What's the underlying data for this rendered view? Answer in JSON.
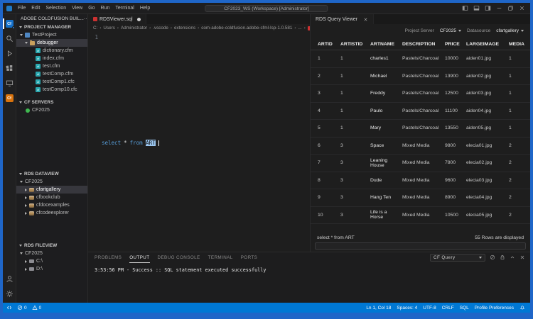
{
  "window": {
    "title": "CF2023_WS (Workspace) [Administrator]",
    "menus": [
      "File",
      "Edit",
      "Selection",
      "View",
      "Go",
      "Run",
      "Terminal",
      "Help"
    ],
    "controls": [
      "toggle-sidebar",
      "toggle-panel",
      "toggle-secondary-sidebar",
      "minimize",
      "restore",
      "close"
    ]
  },
  "activity_bar": {
    "icons": [
      "coldfusion-extension",
      "search",
      "run-debug",
      "extensions",
      "remote-explorer",
      "coldfusion-builder",
      "account",
      "settings-gear"
    ],
    "active": "coldfusion-extension",
    "cf_glyph": "Cf"
  },
  "sidebar": {
    "title": "ADOBE COLDFUSION BUIL...",
    "more_actions": "⋯",
    "sections": [
      {
        "label": "PROJECT MANAGER",
        "items": [
          {
            "label": "TestProject",
            "indent": 0,
            "chevron": "down",
            "icon": "project"
          },
          {
            "label": "debugger",
            "indent": 1,
            "chevron": "down",
            "icon": "folder",
            "selected": true
          },
          {
            "label": "dictionary.cfm",
            "indent": 2,
            "icon": "cf-file"
          },
          {
            "label": "index.cfm",
            "indent": 2,
            "icon": "cf-file"
          },
          {
            "label": "test.cfm",
            "indent": 2,
            "icon": "cf-file"
          },
          {
            "label": "testComp.cfm",
            "indent": 2,
            "icon": "cf-file"
          },
          {
            "label": "testComp1.cfc",
            "indent": 2,
            "icon": "cf-file"
          },
          {
            "label": "testComp10.cfc",
            "indent": 2,
            "icon": "cf-file"
          }
        ]
      },
      {
        "label": "CF SERVERS",
        "items": [
          {
            "label": "CF2025",
            "indent": 0,
            "icon": "server"
          }
        ]
      },
      {
        "label": "RDS DATAVIEW",
        "items": [
          {
            "label": "CF2025",
            "indent": 0,
            "chevron": "down"
          },
          {
            "label": "cfartgallery",
            "indent": 1,
            "chevron": "right",
            "icon": "database",
            "selected": true
          },
          {
            "label": "cfbookclub",
            "indent": 1,
            "chevron": "right",
            "icon": "database"
          },
          {
            "label": "cfdocexamples",
            "indent": 1,
            "chevron": "right",
            "icon": "database"
          },
          {
            "label": "cfcodeexplorer",
            "indent": 1,
            "chevron": "right",
            "icon": "database"
          }
        ]
      },
      {
        "label": "RDS FILEVIEW",
        "items": [
          {
            "label": "CF2025",
            "indent": 0,
            "chevron": "down"
          },
          {
            "label": "C:\\",
            "indent": 1,
            "chevron": "right",
            "icon": "drive"
          },
          {
            "label": "D:\\",
            "indent": 1,
            "chevron": "right",
            "icon": "drive"
          }
        ]
      }
    ]
  },
  "editor": {
    "tab_label": "RDSViewer.sql",
    "modified": true,
    "breadcrumb": [
      "C:",
      "Users",
      "Administrator",
      ".vscode",
      "extensions",
      "com-adobe-coldfusion.adobe-cfml-lsp-1.0.581",
      "...",
      "RD"
    ],
    "line_number": "1",
    "code": {
      "keyword1": "select",
      "operator": "*",
      "keyword2": "from",
      "selected_text": "ART"
    }
  },
  "query_viewer": {
    "tab_label": "RDS Query Viewer",
    "toolbar": {
      "server_label": "Project Server",
      "server_value": "CF2025",
      "datasource_label": "Datasource",
      "datasource_value": "cfartgallery"
    },
    "table": {
      "columns": [
        "ARTID",
        "ARTISTID",
        "ARTNAME",
        "DESCRIPTION",
        "PRICE",
        "LARGEIMAGE",
        "MEDIA"
      ],
      "rows": [
        [
          "1",
          "1",
          "charles1",
          "Pastels/Charcoal",
          "10000",
          "aiden01.jpg",
          "1"
        ],
        [
          "2",
          "1",
          "Michael",
          "Pastels/Charcoal",
          "13900",
          "aiden02.jpg",
          "1"
        ],
        [
          "3",
          "1",
          "Freddy",
          "Pastels/Charcoal",
          "12500",
          "aiden03.jpg",
          "1"
        ],
        [
          "4",
          "1",
          "Paulo",
          "Pastels/Charcoal",
          "11100",
          "aiden04.jpg",
          "1"
        ],
        [
          "5",
          "1",
          "Mary",
          "Pastels/Charcoal",
          "13550",
          "aiden05.jpg",
          "1"
        ],
        [
          "6",
          "3",
          "Space",
          "Mixed Media",
          "9800",
          "elecia01.jpg",
          "2"
        ],
        [
          "7",
          "3",
          "Leaning House",
          "Mixed Media",
          "7800",
          "elecia02.jpg",
          "2"
        ],
        [
          "8",
          "3",
          "Dude",
          "Mixed Media",
          "9600",
          "elecia03.jpg",
          "2"
        ],
        [
          "9",
          "3",
          "Hang Ten",
          "Mixed Media",
          "8900",
          "elecia04.jpg",
          "2"
        ],
        [
          "10",
          "3",
          "Life is a Horse",
          "Mixed Media",
          "10500",
          "elecia05.jpg",
          "2"
        ]
      ]
    },
    "footer": {
      "query": "select * from ART",
      "rows_info": "55 Rows are displayed"
    }
  },
  "bottom_panel": {
    "tabs": [
      "PROBLEMS",
      "OUTPUT",
      "DEBUG CONSOLE",
      "TERMINAL",
      "PORTS"
    ],
    "active_tab": "OUTPUT",
    "channel": "CF Query",
    "output": "3:53:56 PM - Success :: SQL statement executed successfully"
  },
  "status_bar": {
    "errors": "0",
    "warnings": "0",
    "right": [
      "Ln 1, Col 18",
      "Spaces: 4",
      "UTF-8",
      "CRLF",
      "SQL",
      "Profile Preferences"
    ]
  },
  "colors": {
    "statusbar": "#0078d4",
    "frame": "#1f66c8",
    "selection": "#9cc7f0",
    "keyword": "#569cd6"
  }
}
